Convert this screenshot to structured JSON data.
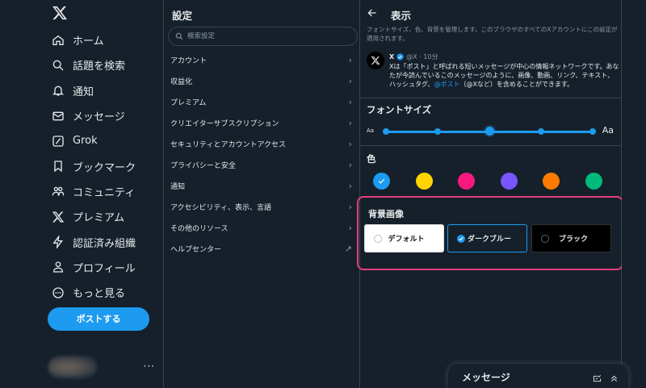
{
  "nav": {
    "items": [
      {
        "label": "ホーム",
        "icon": "home-icon"
      },
      {
        "label": "話題を検索",
        "icon": "search-icon"
      },
      {
        "label": "通知",
        "icon": "bell-icon"
      },
      {
        "label": "メッセージ",
        "icon": "mail-icon"
      },
      {
        "label": "Grok",
        "icon": "grok-icon"
      },
      {
        "label": "ブックマーク",
        "icon": "bookmark-icon"
      },
      {
        "label": "コミュニティ",
        "icon": "community-icon"
      },
      {
        "label": "プレミアム",
        "icon": "x-logo-icon"
      },
      {
        "label": "認証済み組織",
        "icon": "lightning-icon"
      },
      {
        "label": "プロフィール",
        "icon": "person-icon"
      },
      {
        "label": "もっと見る",
        "icon": "more-circle-icon"
      }
    ],
    "post_label": "ポストする",
    "account_more": "···"
  },
  "settings": {
    "title": "設定",
    "search_placeholder": "検索設定",
    "items": [
      {
        "label": "アカウント",
        "chevron": "›"
      },
      {
        "label": "収益化",
        "chevron": "›"
      },
      {
        "label": "プレミアム",
        "chevron": "›"
      },
      {
        "label": "クリエイターサブスクリプション",
        "chevron": "›"
      },
      {
        "label": "セキュリティとアカウントアクセス",
        "chevron": "›"
      },
      {
        "label": "プライバシーと安全",
        "chevron": "›"
      },
      {
        "label": "通知",
        "chevron": "›"
      },
      {
        "label": "アクセシビリティ、表示、言語",
        "chevron": "›"
      },
      {
        "label": "その他のリソース",
        "chevron": "›"
      },
      {
        "label": "ヘルプセンター",
        "chevron": "↗"
      }
    ]
  },
  "display": {
    "title": "表示",
    "description": "フォントサイズ、色、背景を管理します。このブラウザのすべてのXアカウントにこの設定が適用されます。",
    "tweet": {
      "name": "X",
      "handle": "@X · 10分",
      "body_1": "Xは「ポスト」と呼ばれる短いメッセージが中心の情報ネットワークです。あなたが今読んでいるこのメッセージのように、画像、動画、リンク、テキスト、ハッシュタグ、",
      "body_link": "@ポスト",
      "body_2": "（@Xなど）を含めることができます。"
    },
    "font_size_title": "フォントサイズ",
    "aa_small": "Aa",
    "aa_large": "Aa",
    "font_size_level": 3,
    "font_size_steps": 5,
    "color_title": "色",
    "colors": [
      "#1d9bf0",
      "#ffd400",
      "#f91880",
      "#7856ff",
      "#ff7a00",
      "#00ba7c"
    ],
    "selected_color": 0,
    "background_title": "背景画像",
    "backgrounds": [
      {
        "label": "デフォルト",
        "bg": "#ffffff",
        "fg": "#0f1419"
      },
      {
        "label": "ダークブルー",
        "bg": "#15202b",
        "fg": "#e7e9ea"
      },
      {
        "label": "ブラック",
        "bg": "#000000",
        "fg": "#e7e9ea"
      }
    ],
    "selected_background": 1
  },
  "messages_dock": {
    "title": "メッセージ"
  }
}
